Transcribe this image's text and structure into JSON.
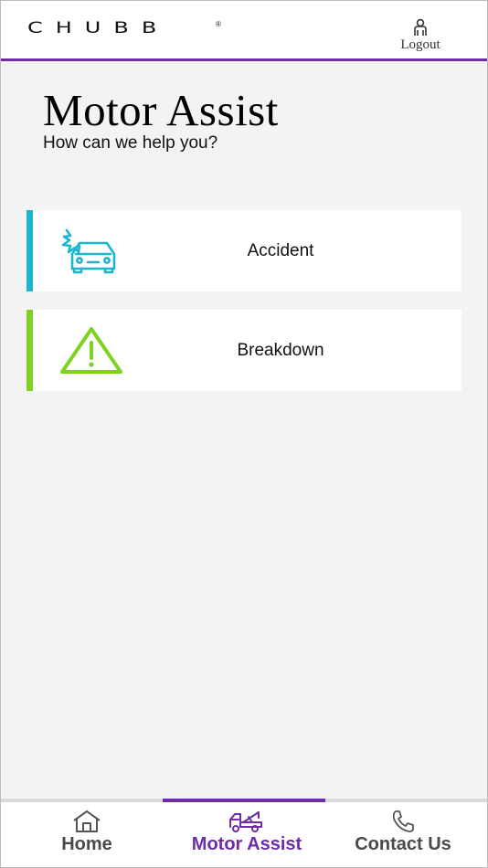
{
  "header": {
    "logo_text": "CHUBB",
    "logo_mark": "®",
    "logout_icon": "person-icon",
    "logout_label": "Logout"
  },
  "page": {
    "title": "Motor Assist",
    "subtitle": "How can we help you?"
  },
  "cards": [
    {
      "label": "Accident",
      "icon": "car-crash-icon",
      "accent": "#1bb7d1"
    },
    {
      "label": "Breakdown",
      "icon": "warning-triangle-icon",
      "accent": "#7ed321"
    }
  ],
  "bottom_nav": {
    "active_index": 1,
    "active_color": "#6e2ca6",
    "items": [
      {
        "label": "Home",
        "icon": "home-icon"
      },
      {
        "label": "Motor Assist",
        "icon": "tow-truck-icon"
      },
      {
        "label": "Contact Us",
        "icon": "phone-icon"
      }
    ]
  },
  "colors": {
    "brand_purple": "#6e2ca6",
    "inactive_nav": "#4a4a4a",
    "background": "#f3f3f3"
  }
}
